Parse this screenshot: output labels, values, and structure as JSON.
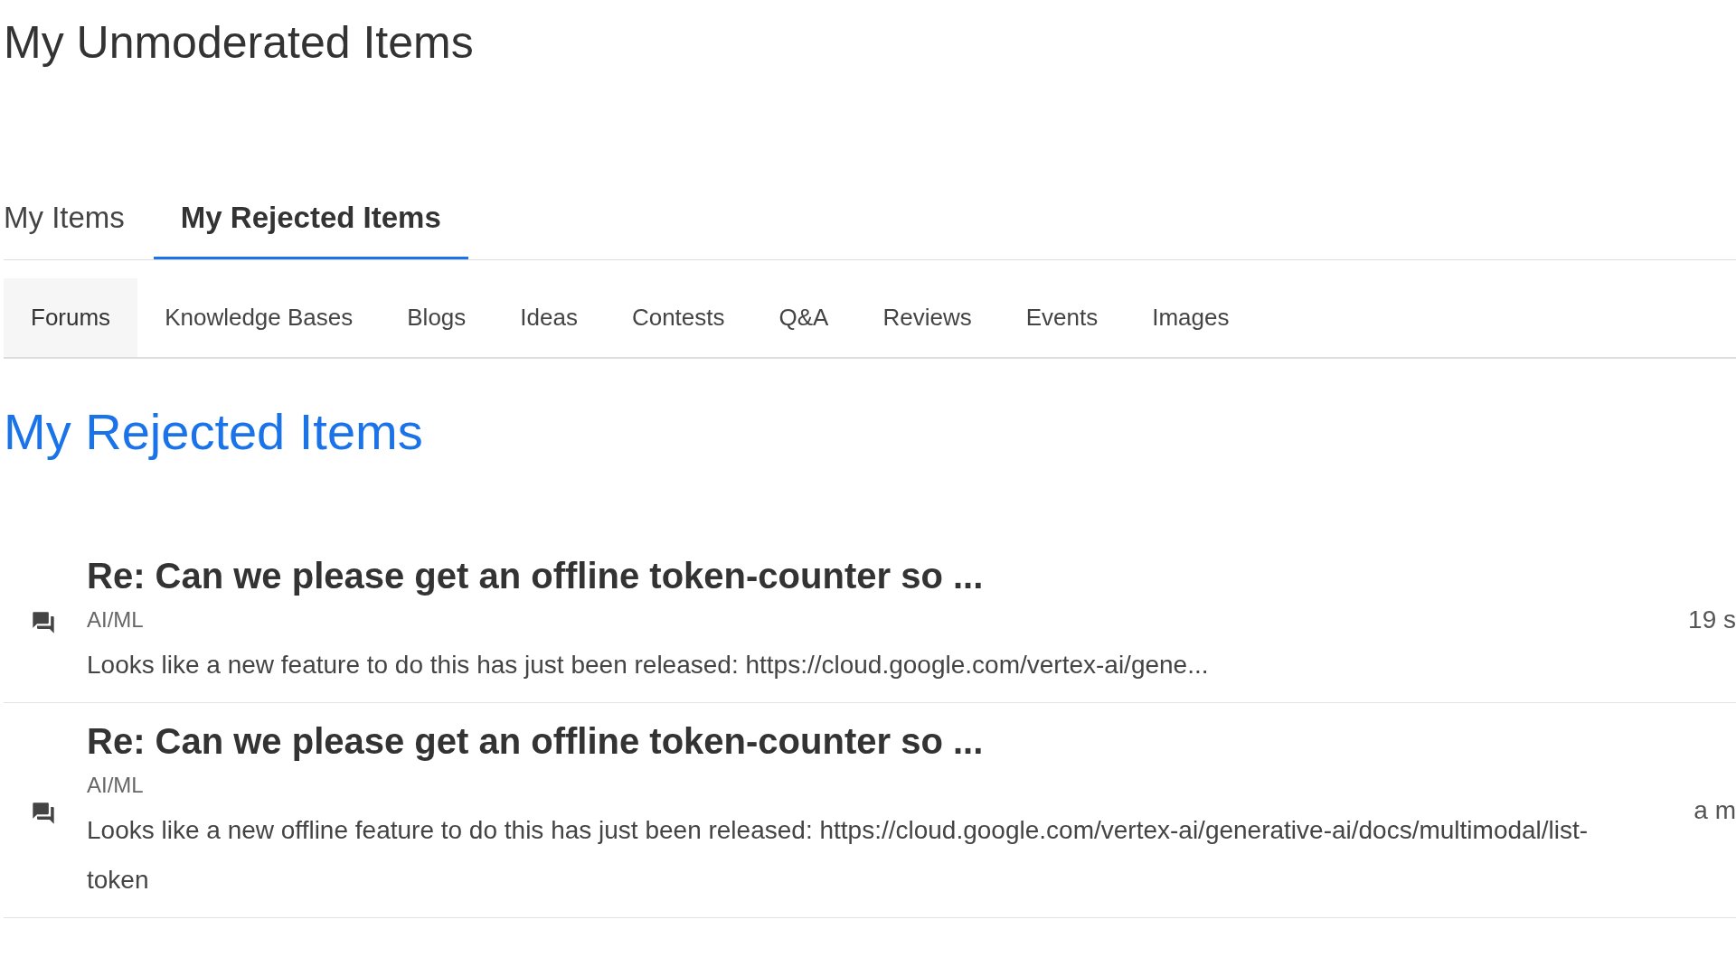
{
  "page_title": "My Unmoderated Items",
  "tabs": [
    {
      "label": "My Items",
      "selected": false
    },
    {
      "label": "My Rejected Items",
      "selected": true
    }
  ],
  "subtabs": [
    {
      "label": "Forums",
      "selected": true
    },
    {
      "label": "Knowledge Bases",
      "selected": false
    },
    {
      "label": "Blogs",
      "selected": false
    },
    {
      "label": "Ideas",
      "selected": false
    },
    {
      "label": "Contests",
      "selected": false
    },
    {
      "label": "Q&A",
      "selected": false
    },
    {
      "label": "Reviews",
      "selected": false
    },
    {
      "label": "Events",
      "selected": false
    },
    {
      "label": "Images",
      "selected": false
    }
  ],
  "section_title": "My Rejected Items",
  "items": [
    {
      "title": "Re: Can we please get an offline token-counter so ...",
      "category": "AI/ML",
      "snippet": "Looks like a new feature to do this has just been released: https://cloud.google.com/vertex-ai/gene...",
      "time": "19 s"
    },
    {
      "title": "Re: Can we please get an offline token-counter so ...",
      "category": "AI/ML",
      "snippet": "Looks like a new offline feature to do this has just been released: https://cloud.google.com/vertex-ai/generative-ai/docs/multimodal/list-token",
      "time": "a m"
    }
  ]
}
